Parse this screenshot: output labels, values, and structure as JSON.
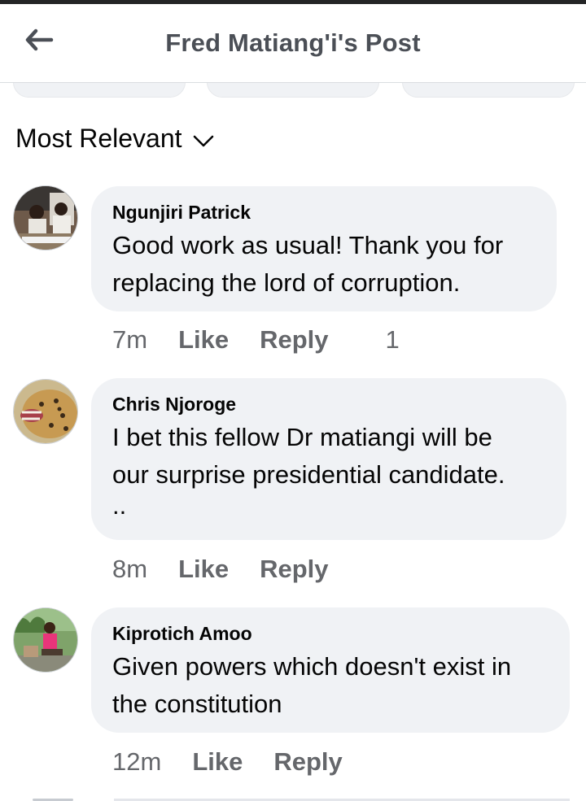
{
  "header": {
    "title": "Fred Matiang'i's Post",
    "back_icon": "arrow-left-icon"
  },
  "sort": {
    "label": "Most Relevant",
    "icon": "chevron-down-icon"
  },
  "colors": {
    "bubble": "#f0f2f5",
    "meta": "#65676b",
    "title": "#4b4f56",
    "text": "#050505"
  },
  "comments": [
    {
      "author": "Ngunjiri Patrick",
      "lines": [
        "Good work as usual! Thank you for",
        "replacing the lord of corruption."
      ],
      "time": "7m",
      "like": "Like",
      "reply": "Reply",
      "reactions": "1"
    },
    {
      "author": "Chris Njoroge",
      "lines": [
        "I bet this fellow Dr matiangi will be",
        "our surprise presidential candidate.",
        ".."
      ],
      "time": "8m",
      "like": "Like",
      "reply": "Reply"
    },
    {
      "author": "Kiprotich Amoo",
      "lines": [
        "Given powers which doesn't exist in",
        "the constitution"
      ],
      "time": "12m",
      "like": "Like",
      "reply": "Reply"
    }
  ]
}
